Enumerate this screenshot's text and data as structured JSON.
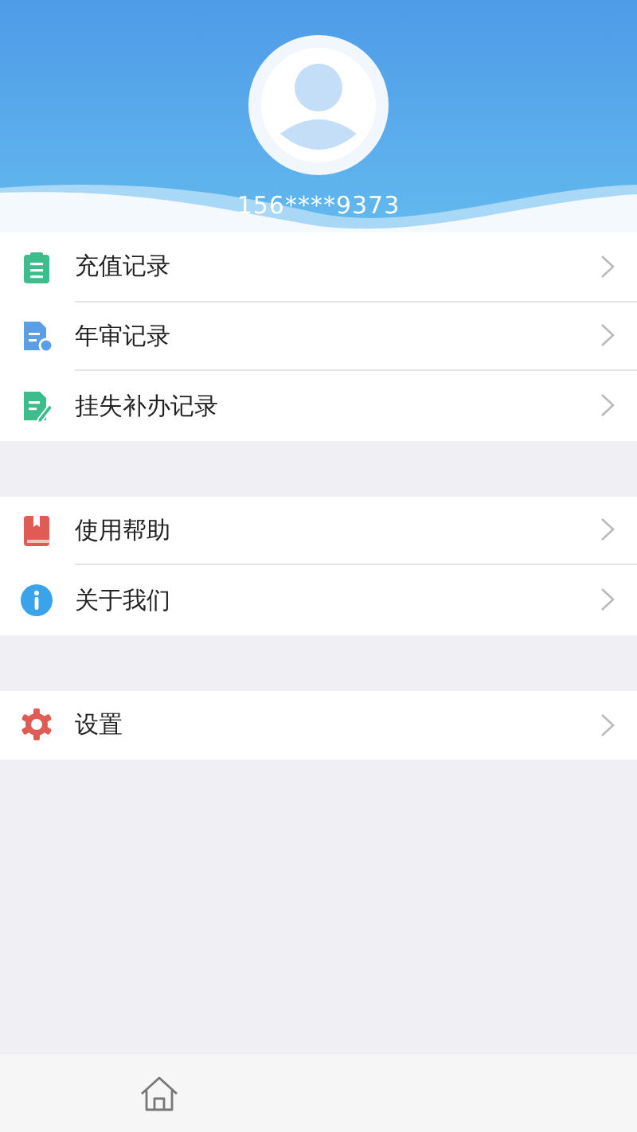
{
  "profile": {
    "phone": "156****9373"
  },
  "sections": [
    {
      "items": [
        {
          "label": "充值记录",
          "kind": "clipboard"
        },
        {
          "label": "年审记录",
          "kind": "document"
        },
        {
          "label": "挂失补办记录",
          "kind": "edit"
        }
      ]
    },
    {
      "items": [
        {
          "label": "使用帮助",
          "kind": "book"
        },
        {
          "label": "关于我们",
          "kind": "info"
        }
      ]
    },
    {
      "items": [
        {
          "label": "设置",
          "kind": "gear"
        }
      ]
    }
  ],
  "tab_bar": {
    "tabs": [
      {
        "kind": "home"
      }
    ]
  }
}
